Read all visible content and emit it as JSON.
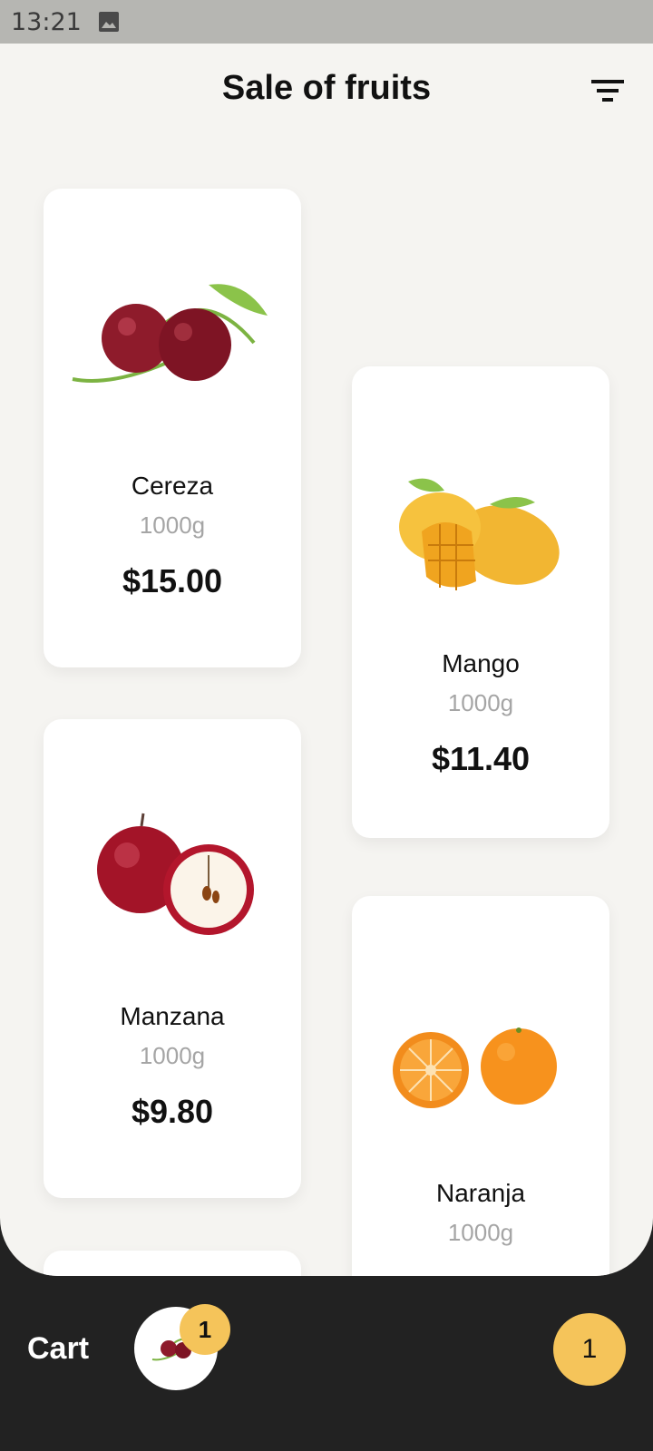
{
  "status_bar": {
    "time": "13:21",
    "icons": [
      "image-icon"
    ]
  },
  "header": {
    "title": "Sale of fruits",
    "filter_icon": "filter-icon"
  },
  "products": [
    {
      "name": "Cereza",
      "weight": "1000g",
      "price": "$15.00",
      "image": "cherry-image"
    },
    {
      "name": "Mango",
      "weight": "1000g",
      "price": "$11.40",
      "image": "mango-image"
    },
    {
      "name": "Manzana",
      "weight": "1000g",
      "price": "$9.80",
      "image": "apple-image"
    },
    {
      "name": "Naranja",
      "weight": "1000g",
      "price": "",
      "image": "orange-image"
    }
  ],
  "cart": {
    "label": "Cart",
    "item_count": "1",
    "total_count": "1"
  },
  "colors": {
    "accent": "#f5c45a",
    "background": "#f5f4f1",
    "bottom_bar": "#222222"
  }
}
